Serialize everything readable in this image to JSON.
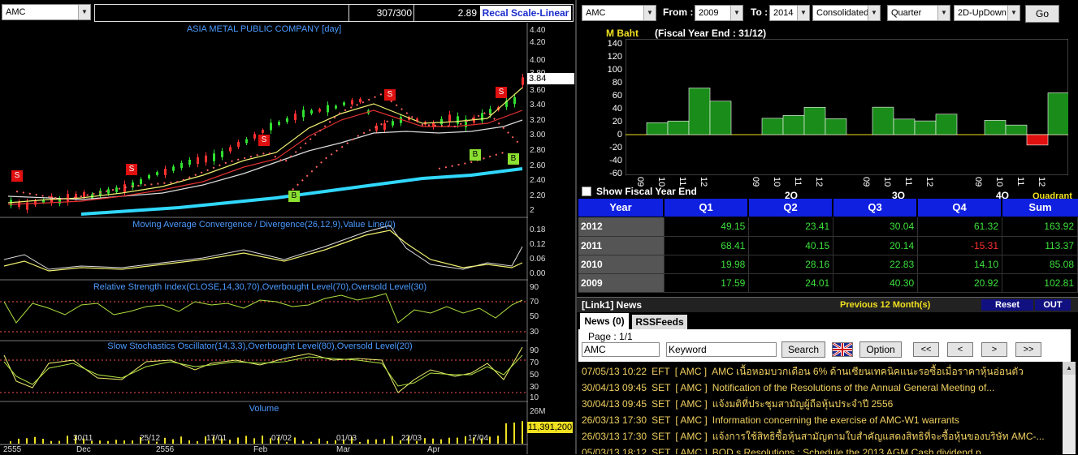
{
  "chart_toolbar": {
    "symbol": "AMC",
    "count": "307/300",
    "value": "2.89",
    "scale_button": "Recal Scale-Linear"
  },
  "chart": {
    "title": "ASIA METAL PUBLIC COMPANY [day]",
    "price_ticks": [
      "4.40",
      "4.20",
      "4.00",
      "3.80",
      "3.60",
      "3.40",
      "3.20",
      "3.00",
      "2.80",
      "2.60",
      "2.40",
      "2.20",
      "2"
    ],
    "last_price": "3.84",
    "macd_title": "Moving Average Convergence / Divergence(26,12,9),Value Line(0)",
    "macd_ticks": [
      "0.18",
      "0.12",
      "0.06",
      "0.00"
    ],
    "rsi_title": "Relative Strength Index(CLOSE,14,30,70),Overbought Level(70),Oversold Level(30)",
    "rsi_ticks": [
      "90",
      "70",
      "50",
      "30"
    ],
    "stoch_title": "Slow Stochastics Oscillator(14,3,3),Overbought Level(80),Oversold Level(20)",
    "stoch_ticks": [
      "90",
      "70",
      "50",
      "30",
      "10"
    ],
    "volume_title": "Volume",
    "volume_tick": "26M",
    "volume_last": "11,391,200",
    "date_labels": [
      "30/11",
      "25/12",
      "17/01",
      "07/02",
      "01/03",
      "22/03",
      "17/04"
    ],
    "period_labels": [
      "2555",
      "Dec",
      "2556",
      "Feb",
      "Mar",
      "Apr"
    ],
    "signals": [
      {
        "label": "S",
        "type": "sell"
      },
      {
        "label": "S",
        "type": "sell"
      },
      {
        "label": "S",
        "type": "sell"
      },
      {
        "label": "S",
        "type": "sell"
      },
      {
        "label": "S",
        "type": "sell"
      },
      {
        "label": "S",
        "type": "sell"
      },
      {
        "label": "B",
        "type": "buy"
      },
      {
        "label": "B",
        "type": "buy"
      },
      {
        "label": "B",
        "type": "buy"
      }
    ]
  },
  "financial_toolbar": {
    "symbol": "AMC",
    "from_label": "From :",
    "from_value": "2009",
    "to_label": "To :",
    "to_value": "2014",
    "statement": "Consolidated",
    "period": "Quarter",
    "view": "2D-UpDown",
    "go_button": "Go"
  },
  "financial_chart": {
    "unit": "M Baht",
    "subtitle": "(Fiscal Year End : 31/12)",
    "y_ticks": [
      "140",
      "120",
      "100",
      "80",
      "60",
      "40",
      "20",
      "0",
      "-20",
      "-40",
      "-60"
    ],
    "group_labels": [
      "2Q",
      "3Q",
      "4Q"
    ],
    "bar_ticks": [
      "09",
      "10",
      "11",
      "12"
    ],
    "quadrant_label": "Quadrant",
    "show_fiscal_label": "Show Fiscal Year End"
  },
  "chart_data": {
    "type": "bar",
    "series": [
      {
        "name": "Q1",
        "values": [
          17.59,
          19.98,
          68.41,
          49.15
        ]
      },
      {
        "name": "Q2",
        "values": [
          24.01,
          28.16,
          40.15,
          23.41
        ]
      },
      {
        "name": "Q3",
        "values": [
          40.3,
          22.83,
          20.14,
          30.04
        ]
      },
      {
        "name": "Q4",
        "values": [
          20.92,
          14.1,
          -15.31,
          61.32
        ]
      }
    ],
    "categories": [
      "2009",
      "2010",
      "2011",
      "2012"
    ],
    "ylim": [
      -60,
      140
    ],
    "colors": {
      "positive": "#1a8c1a",
      "negative": "#e01010"
    }
  },
  "table": {
    "headers": [
      "Year",
      "Q1",
      "Q2",
      "Q3",
      "Q4",
      "Sum"
    ],
    "rows": [
      {
        "year": "2012",
        "q1": "49.15",
        "q2": "23.41",
        "q3": "30.04",
        "q4": "61.32",
        "sum": "163.92"
      },
      {
        "year": "2011",
        "q1": "68.41",
        "q2": "40.15",
        "q3": "20.14",
        "q4": "-15.31",
        "sum": "113.37"
      },
      {
        "year": "2010",
        "q1": "19.98",
        "q2": "28.16",
        "q3": "22.83",
        "q4": "14.10",
        "sum": "85.08"
      },
      {
        "year": "2009",
        "q1": "17.59",
        "q2": "24.01",
        "q3": "40.30",
        "q4": "20.92",
        "sum": "102.81"
      }
    ]
  },
  "news_header": {
    "title": "[Link1] News",
    "previous": "Previous 12 Month(s)",
    "reset_button": "Reset",
    "out_button": "OUT"
  },
  "news_tabs": {
    "news": "News (0)",
    "rss": "RSSFeeds"
  },
  "news_controls": {
    "page": "Page : 1/1",
    "symbol": "AMC",
    "keyword": "Keyword",
    "search_button": "Search",
    "option_button": "Option",
    "nav": [
      "<<",
      "<",
      ">",
      ">>"
    ]
  },
  "news": [
    {
      "date": "07/05/13 10:22",
      "src": "EFT",
      "sym": "[ AMC ]",
      "text": "AMC เนื้อหอมบวกเดือน 6% ด้านเซียนเทคนิคแนะรอซื้อเมื่อราคาหุ้นอ่อนตัว"
    },
    {
      "date": "30/04/13 09:45",
      "src": "SET",
      "sym": "[ AMC ]",
      "text": "Notification of the Resolutions of the Annual General Meeting of..."
    },
    {
      "date": "30/04/13 09:45",
      "src": "SET",
      "sym": "[ AMC ]",
      "text": "แจ้งมติที่ประชุมสามัญผู้ถือหุ้นประจำปี 2556"
    },
    {
      "date": "26/03/13 17:30",
      "src": "SET",
      "sym": "[ AMC ]",
      "text": "Information concerning the exercise of AMC-W1 warrants"
    },
    {
      "date": "26/03/13 17:30",
      "src": "SET",
      "sym": "[ AMC ]",
      "text": "แจ้งการใช้สิทธิซื้อหุ้นสามัญตามใบสำคัญแสดงสิทธิที่จะซื้อหุ้นของบริษัท AMC-..."
    },
    {
      "date": "05/03/13 18:12",
      "src": "SET",
      "sym": "[ AMC ]",
      "text": "BOD s Resolutions : Schedule the 2013 AGM Cash dividend p..."
    }
  ]
}
